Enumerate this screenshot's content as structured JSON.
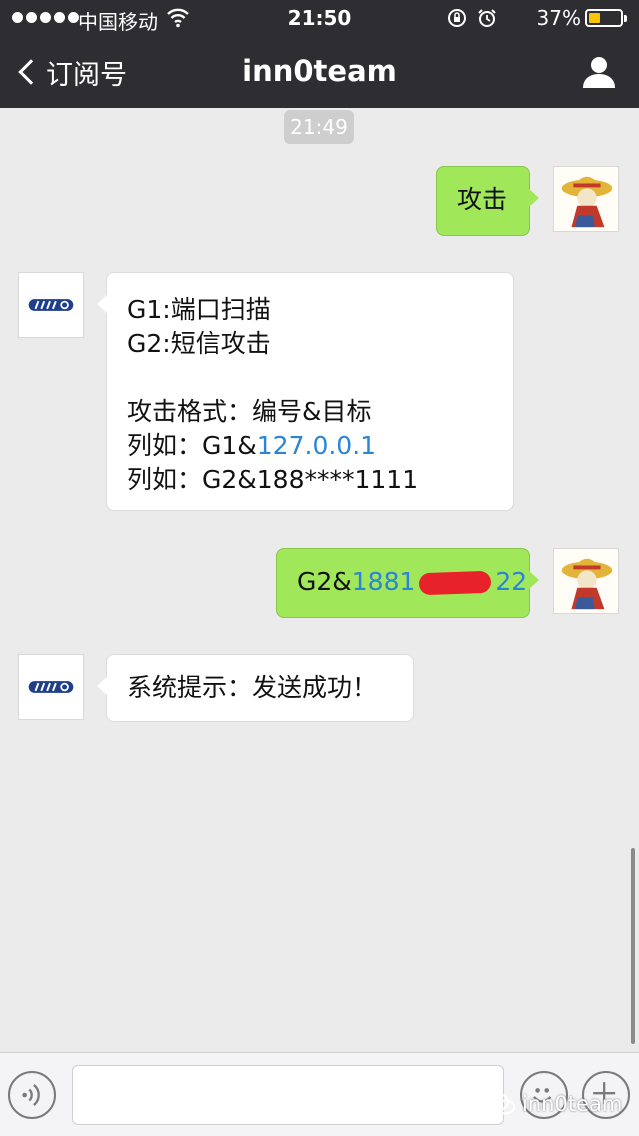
{
  "status_bar": {
    "carrier": "中国移动",
    "time": "21:50",
    "battery_percent": "37%",
    "battery_level": 0.37,
    "icons": [
      "signal-dots-icon",
      "wifi-icon",
      "orientation-lock-icon",
      "alarm-icon",
      "battery-icon"
    ]
  },
  "nav": {
    "back_label": "订阅号",
    "title": "inn0team",
    "right_icon": "person-icon"
  },
  "chat": {
    "time_badge": "21:49",
    "messages": [
      {
        "direction": "out",
        "lines": [
          "攻击"
        ]
      },
      {
        "direction": "in",
        "lines": [
          "G1:端口扫描",
          "G2:短信攻击",
          "",
          "攻击格式：编号&目标",
          "列如：G1&",
          "列如：G2&188****1111"
        ],
        "link_text": "127.0.0.1"
      },
      {
        "direction": "out",
        "prefix": "G2&",
        "link_start": "1881",
        "link_end": "22",
        "redacted": true
      },
      {
        "direction": "in",
        "lines": [
          "系统提示：发送成功！"
        ]
      }
    ]
  },
  "input_bar": {
    "placeholder": "",
    "icons": [
      "voice-icon",
      "emoji-icon",
      "plus-icon"
    ]
  },
  "watermark": {
    "text": "inn0team",
    "icon": "wechat-icon"
  },
  "colors": {
    "nav_bg": "#2e2e32",
    "outgoing_bubble": "#a0e75a",
    "incoming_bubble": "#ffffff",
    "link": "#2b84d6",
    "chat_bg": "#ebebeb"
  }
}
